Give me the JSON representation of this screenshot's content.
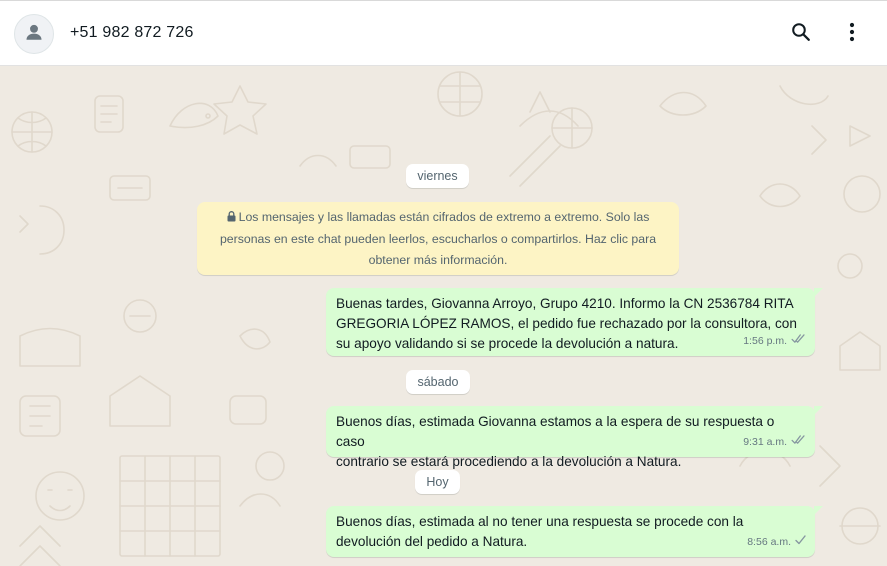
{
  "header": {
    "avatar_icon": "default-user-avatar-icon",
    "contact_name": "+51 982 872 726",
    "search_icon": "search-icon",
    "menu_icon": "more-vertical-icon"
  },
  "chat": {
    "background_color": "#efeae2",
    "bubble_color": "#d9fdd3",
    "notice_color": "#fdf4c5",
    "date_chips": {
      "friday": "viernes",
      "saturday": "sábado",
      "today": "Hoy"
    },
    "encryption_notice": {
      "icon": "lock-icon",
      "line1": "Los mensajes y las llamadas están cifrados de extremo a extremo. Solo las",
      "line2": "personas en este chat pueden leerlos, escucharlos o compartirlos. Haz clic para",
      "line3": "obtener más información."
    },
    "messages": [
      {
        "lines": [
          "Buenas tardes, Giovanna Arroyo, Grupo 4210. Informo la CN 2536784 RITA",
          "GREGORIA LÓPEZ RAMOS, el pedido fue rechazado por la consultora, con",
          "su apoyo validando si se procede la devolución a natura."
        ],
        "time": "1:56 p.m.",
        "status_icon": "double-check-icon"
      },
      {
        "lines": [
          "Buenos días, estimada Giovanna estamos a la espera de su respuesta o caso",
          "contrario se estará procediendo a la devolución a Natura."
        ],
        "time": "9:31 a.m.",
        "status_icon": "double-check-icon"
      },
      {
        "lines": [
          "Buenos días, estimada al no tener una respuesta se procede con la",
          "devolución del pedido a Natura."
        ],
        "time": "8:56 a.m.",
        "status_icon": "single-check-icon"
      }
    ]
  }
}
